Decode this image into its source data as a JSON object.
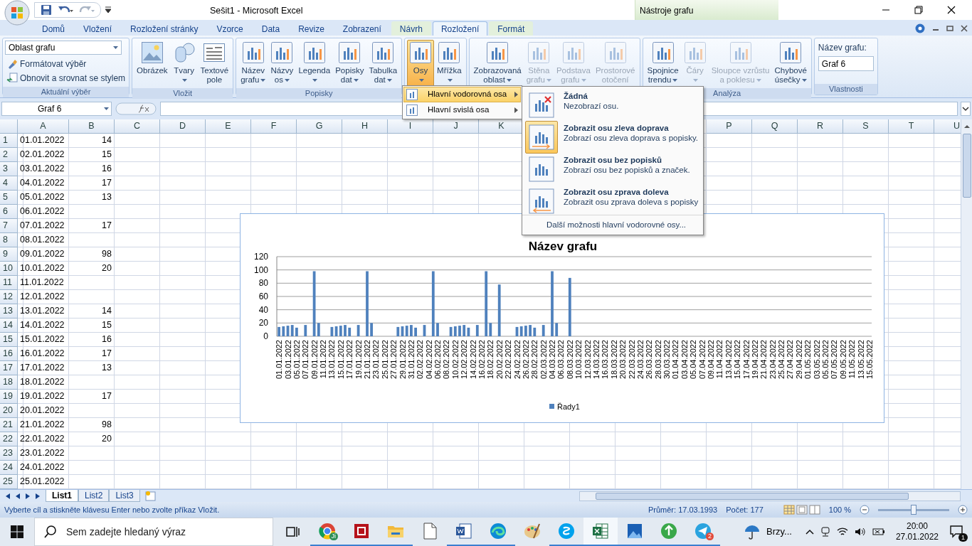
{
  "title_bar": {
    "title": "Sešit1 - Microsoft Excel",
    "context_label": "Nástroje grafu"
  },
  "tabs": [
    {
      "label": "Domů",
      "selected": false,
      "kind": "standard"
    },
    {
      "label": "Vložení",
      "selected": false,
      "kind": "standard"
    },
    {
      "label": "Rozložení stránky",
      "selected": false,
      "kind": "standard"
    },
    {
      "label": "Vzorce",
      "selected": false,
      "kind": "standard"
    },
    {
      "label": "Data",
      "selected": false,
      "kind": "standard"
    },
    {
      "label": "Revize",
      "selected": false,
      "kind": "standard"
    },
    {
      "label": "Zobrazení",
      "selected": false,
      "kind": "standard"
    },
    {
      "label": "Návrh",
      "selected": false,
      "kind": "contextual"
    },
    {
      "label": "Rozložení",
      "selected": true,
      "kind": "contextual"
    },
    {
      "label": "Formát",
      "selected": false,
      "kind": "contextual"
    }
  ],
  "ribbon_groups": [
    {
      "kind": "selection",
      "label": "Aktuální výběr",
      "dropdown": "Oblast grafu",
      "commands": [
        "Formátovat výběr",
        "Obnovit a srovnat se stylem"
      ]
    },
    {
      "kind": "buttons",
      "label": "Vložit",
      "buttons": [
        {
          "lines": [
            "Obrázek"
          ],
          "dropdown": false,
          "disabled": false,
          "selected": false
        },
        {
          "lines": [
            "Tvary"
          ],
          "dropdown": true,
          "disabled": false,
          "selected": false
        },
        {
          "lines": [
            "Textové",
            "pole"
          ],
          "dropdown": false,
          "disabled": false,
          "selected": false
        }
      ]
    },
    {
      "kind": "buttons",
      "label": "Popisky",
      "buttons": [
        {
          "lines": [
            "Název",
            "grafu"
          ],
          "dropdown": true,
          "disabled": false,
          "selected": false
        },
        {
          "lines": [
            "Názvy",
            "os"
          ],
          "dropdown": true,
          "disabled": false,
          "selected": false
        },
        {
          "lines": [
            "Legenda"
          ],
          "dropdown": true,
          "disabled": false,
          "selected": false
        },
        {
          "lines": [
            "Popisky",
            "dat"
          ],
          "dropdown": true,
          "disabled": false,
          "selected": false
        },
        {
          "lines": [
            "Tabulka",
            "dat"
          ],
          "dropdown": true,
          "disabled": false,
          "selected": false
        }
      ]
    },
    {
      "kind": "buttons",
      "buttons": [
        {
          "lines": [
            "Osy"
          ],
          "dropdown": true,
          "disabled": false,
          "selected": true
        },
        {
          "lines": [
            "Mřížka"
          ],
          "dropdown": true,
          "disabled": false,
          "selected": false
        }
      ]
    },
    {
      "kind": "buttons",
      "buttons": [
        {
          "lines": [
            "Zobrazovaná",
            "oblast"
          ],
          "dropdown": true,
          "disabled": false,
          "selected": false
        },
        {
          "lines": [
            "Stěna",
            "grafu"
          ],
          "dropdown": true,
          "disabled": true,
          "selected": false
        },
        {
          "lines": [
            "Podstava",
            "grafu"
          ],
          "dropdown": true,
          "disabled": true,
          "selected": false
        },
        {
          "lines": [
            "Prostorové",
            "otočení"
          ],
          "dropdown": false,
          "disabled": true,
          "selected": false
        }
      ]
    },
    {
      "kind": "buttons",
      "label": "Analýza",
      "buttons": [
        {
          "lines": [
            "Spojnice",
            "trendu"
          ],
          "dropdown": true,
          "disabled": false,
          "selected": false
        },
        {
          "lines": [
            "Čáry"
          ],
          "dropdown": true,
          "disabled": true,
          "selected": false
        },
        {
          "lines": [
            "Sloupce vzrůstu",
            "a poklesu"
          ],
          "dropdown": true,
          "disabled": true,
          "selected": false
        },
        {
          "lines": [
            "Chybové",
            "úsečky"
          ],
          "dropdown": true,
          "disabled": false,
          "selected": false
        }
      ]
    },
    {
      "kind": "properties",
      "label": "Vlastnosti",
      "field_label": "Název grafu:",
      "value": "Graf 6"
    }
  ],
  "formula_bar": {
    "name_box": "Graf 6"
  },
  "sheet": {
    "columns": [
      "A",
      "B",
      "C",
      "D",
      "E",
      "F",
      "G",
      "H",
      "I",
      "J",
      "K",
      "P",
      "Q",
      "R",
      "S",
      "T",
      "U"
    ],
    "rows": [
      {
        "n": "1",
        "date": "01.01.2022",
        "value": "14"
      },
      {
        "n": "2",
        "date": "02.01.2022",
        "value": "15"
      },
      {
        "n": "3",
        "date": "03.01.2022",
        "value": "16"
      },
      {
        "n": "4",
        "date": "04.01.2022",
        "value": "17"
      },
      {
        "n": "5",
        "date": "05.01.2022",
        "value": "13"
      },
      {
        "n": "6",
        "date": "06.01.2022"
      },
      {
        "n": "7",
        "date": "07.01.2022",
        "value": "17"
      },
      {
        "n": "8",
        "date": "08.01.2022"
      },
      {
        "n": "9",
        "date": "09.01.2022",
        "value": "98"
      },
      {
        "n": "10",
        "date": "10.01.2022",
        "value": "20"
      },
      {
        "n": "11",
        "date": "11.01.2022"
      },
      {
        "n": "12",
        "date": "12.01.2022"
      },
      {
        "n": "13",
        "date": "13.01.2022",
        "value": "14"
      },
      {
        "n": "14",
        "date": "14.01.2022",
        "value": "15"
      },
      {
        "n": "15",
        "date": "15.01.2022",
        "value": "16"
      },
      {
        "n": "16",
        "date": "16.01.2022",
        "value": "17"
      },
      {
        "n": "17",
        "date": "17.01.2022",
        "value": "13"
      },
      {
        "n": "18",
        "date": "18.01.2022"
      },
      {
        "n": "19",
        "date": "19.01.2022",
        "value": "17"
      },
      {
        "n": "20",
        "date": "20.01.2022"
      },
      {
        "n": "21",
        "date": "21.01.2022",
        "value": "98"
      },
      {
        "n": "22",
        "date": "22.01.2022",
        "value": "20"
      },
      {
        "n": "23",
        "date": "23.01.2022"
      },
      {
        "n": "24",
        "date": "24.01.2022"
      },
      {
        "n": "25",
        "date": "25.01.2022"
      }
    ]
  },
  "chart": {
    "chart_data": {
      "type": "bar",
      "title": "Název grafu",
      "ylim": [
        0,
        120
      ],
      "yticks": [
        0,
        20,
        40,
        60,
        80,
        100,
        120
      ],
      "grid": true,
      "categories": [
        "01.01.2022",
        null,
        "03.01.2022",
        null,
        "05.01.2022",
        null,
        "07.01.2022",
        null,
        "09.01.2022",
        null,
        "11.01.2022",
        null,
        "13.01.2022",
        null,
        "15.01.2022",
        null,
        "17.01.2022",
        null,
        "19.01.2022",
        null,
        "21.01.2022",
        null,
        "23.01.2022",
        null,
        "25.01.2022",
        null,
        "27.01.2022",
        null,
        "29.01.2022",
        null,
        "31.01.2022",
        null,
        "02.02.2022",
        null,
        "04.02.2022",
        null,
        "06.02.2022",
        null,
        "08.02.2022",
        null,
        "10.02.2022",
        null,
        "12.02.2022",
        null,
        "14.02.2022",
        null,
        "16.02.2022",
        null,
        "18.02.2022",
        null,
        "20.02.2022",
        null,
        "22.02.2022",
        null,
        "24.02.2022",
        null,
        "26.02.2022",
        null,
        "28.02.2022",
        null,
        "02.03.2022",
        null,
        "04.03.2022",
        null,
        "06.03.2022",
        null,
        "08.03.2022",
        null,
        "10.03.2022",
        null,
        "12.03.2022",
        null,
        "14.03.2022",
        null,
        "16.03.2022",
        null,
        "18.03.2022",
        null,
        "20.03.2022",
        null,
        "22.03.2022",
        null,
        "24.03.2022",
        null,
        "26.03.2022",
        null,
        "28.03.2022",
        null,
        "30.03.2022",
        null,
        "01.04.2022",
        null,
        "03.04.2022",
        null,
        "05.04.2022",
        null,
        "07.04.2022",
        null,
        "09.04.2022",
        null,
        "11.04.2022",
        null,
        "13.04.2022",
        null,
        "15.04.2022",
        null,
        "17.04.2022",
        null,
        "19.04.2022",
        null,
        "21.04.2022",
        null,
        "23.04.2022",
        null,
        "25.04.2022",
        null,
        "27.04.2022",
        null,
        "29.04.2022",
        null,
        "01.05.2022",
        null,
        "03.05.2022",
        null,
        "05.05.2022",
        null,
        "07.05.2022",
        null,
        "09.05.2022",
        null,
        "11.05.2022",
        null,
        "13.05.2022",
        null,
        "15.05.2022"
      ],
      "series": [
        {
          "name": "Řady1",
          "color": "#4f81bd",
          "values": [
            14,
            15,
            16,
            17,
            13,
            null,
            17,
            null,
            98,
            20,
            null,
            null,
            14,
            15,
            16,
            17,
            13,
            null,
            17,
            null,
            98,
            20,
            null,
            null,
            null,
            null,
            null,
            14,
            15,
            16,
            17,
            13,
            null,
            17,
            null,
            98,
            20,
            null,
            null,
            14,
            15,
            16,
            17,
            13,
            null,
            17,
            null,
            98,
            20,
            null,
            78,
            null,
            null,
            null,
            14,
            15,
            16,
            17,
            13,
            null,
            17,
            null,
            98,
            20,
            null,
            null,
            88,
            null,
            null,
            null,
            null,
            null,
            null,
            null,
            null,
            null,
            null,
            null,
            null,
            null,
            null,
            null,
            null,
            null,
            null,
            null,
            null,
            null,
            null,
            null,
            null,
            null,
            null,
            null,
            null,
            null,
            null,
            null,
            null,
            null,
            null,
            null,
            null,
            null,
            null,
            null,
            null,
            null,
            null,
            null,
            null,
            null,
            null,
            null,
            null,
            null,
            null,
            null,
            null,
            null,
            null,
            null,
            null,
            null,
            null,
            null,
            null,
            null,
            null,
            null,
            null,
            null,
            null,
            null,
            null
          ]
        }
      ]
    }
  },
  "menu": {
    "items": [
      {
        "label": "Hlavní vodorovná osa",
        "selected": true
      },
      {
        "label": "Hlavní svislá osa",
        "selected": false
      }
    ],
    "submenu": {
      "options": [
        {
          "kind": "none",
          "title": "Žádná",
          "description": "Nezobrazí osu.",
          "selected": false
        },
        {
          "kind": "left_right",
          "title": "Zobrazit osu zleva doprava",
          "description": "Zobrazí osu zleva doprava s popisky.",
          "selected": true
        },
        {
          "kind": "no_labels",
          "title": "Zobrazit osu bez popisků",
          "description": "Zobrazí osu bez popisků a značek.",
          "selected": false
        },
        {
          "kind": "right_left",
          "title": "Zobrazit osu zprava doleva",
          "description": "Zobrazit osu zprava doleva s popisky",
          "selected": false
        }
      ],
      "more": "Další možnosti hlavní vodorovné osy..."
    }
  },
  "sheet_tabs": [
    {
      "label": "List1",
      "selected": true
    },
    {
      "label": "List2",
      "selected": false
    },
    {
      "label": "List3",
      "selected": false
    }
  ],
  "status_bar": {
    "message": "Vyberte cíl a stiskněte klávesu Enter nebo zvolte příkaz Vložit.",
    "average": "Průměr: 17.03.1993",
    "count": "Počet: 177",
    "zoom": {
      "label": "100 %",
      "level": 0.5
    }
  },
  "taskbar": {
    "search_placeholder": "Sem zadejte hledaný výraz",
    "apps": [
      {
        "kind": "browser",
        "running": true,
        "selected": false,
        "badge": "Ji"
      },
      {
        "kind": "frame",
        "running": true,
        "selected": false
      },
      {
        "kind": "folder",
        "running": true,
        "selected": false
      },
      {
        "kind": "page",
        "running": false,
        "selected": false
      },
      {
        "kind": "document",
        "running": true,
        "selected": false
      },
      {
        "kind": "swirl",
        "running": true,
        "selected": false
      },
      {
        "kind": "palette",
        "running": false,
        "selected": false
      },
      {
        "kind": "chat",
        "running": true,
        "selected": false
      },
      {
        "kind": "spreadsheet",
        "running": true,
        "selected": true
      },
      {
        "kind": "image",
        "running": true,
        "selected": false
      },
      {
        "kind": "upload",
        "running": true,
        "selected": false
      },
      {
        "kind": "plane",
        "running": true,
        "selected": false,
        "badge": "2"
      }
    ],
    "weather": "Brzy...",
    "time": "20:00",
    "date": "27.01.2022",
    "notifications": "1"
  }
}
